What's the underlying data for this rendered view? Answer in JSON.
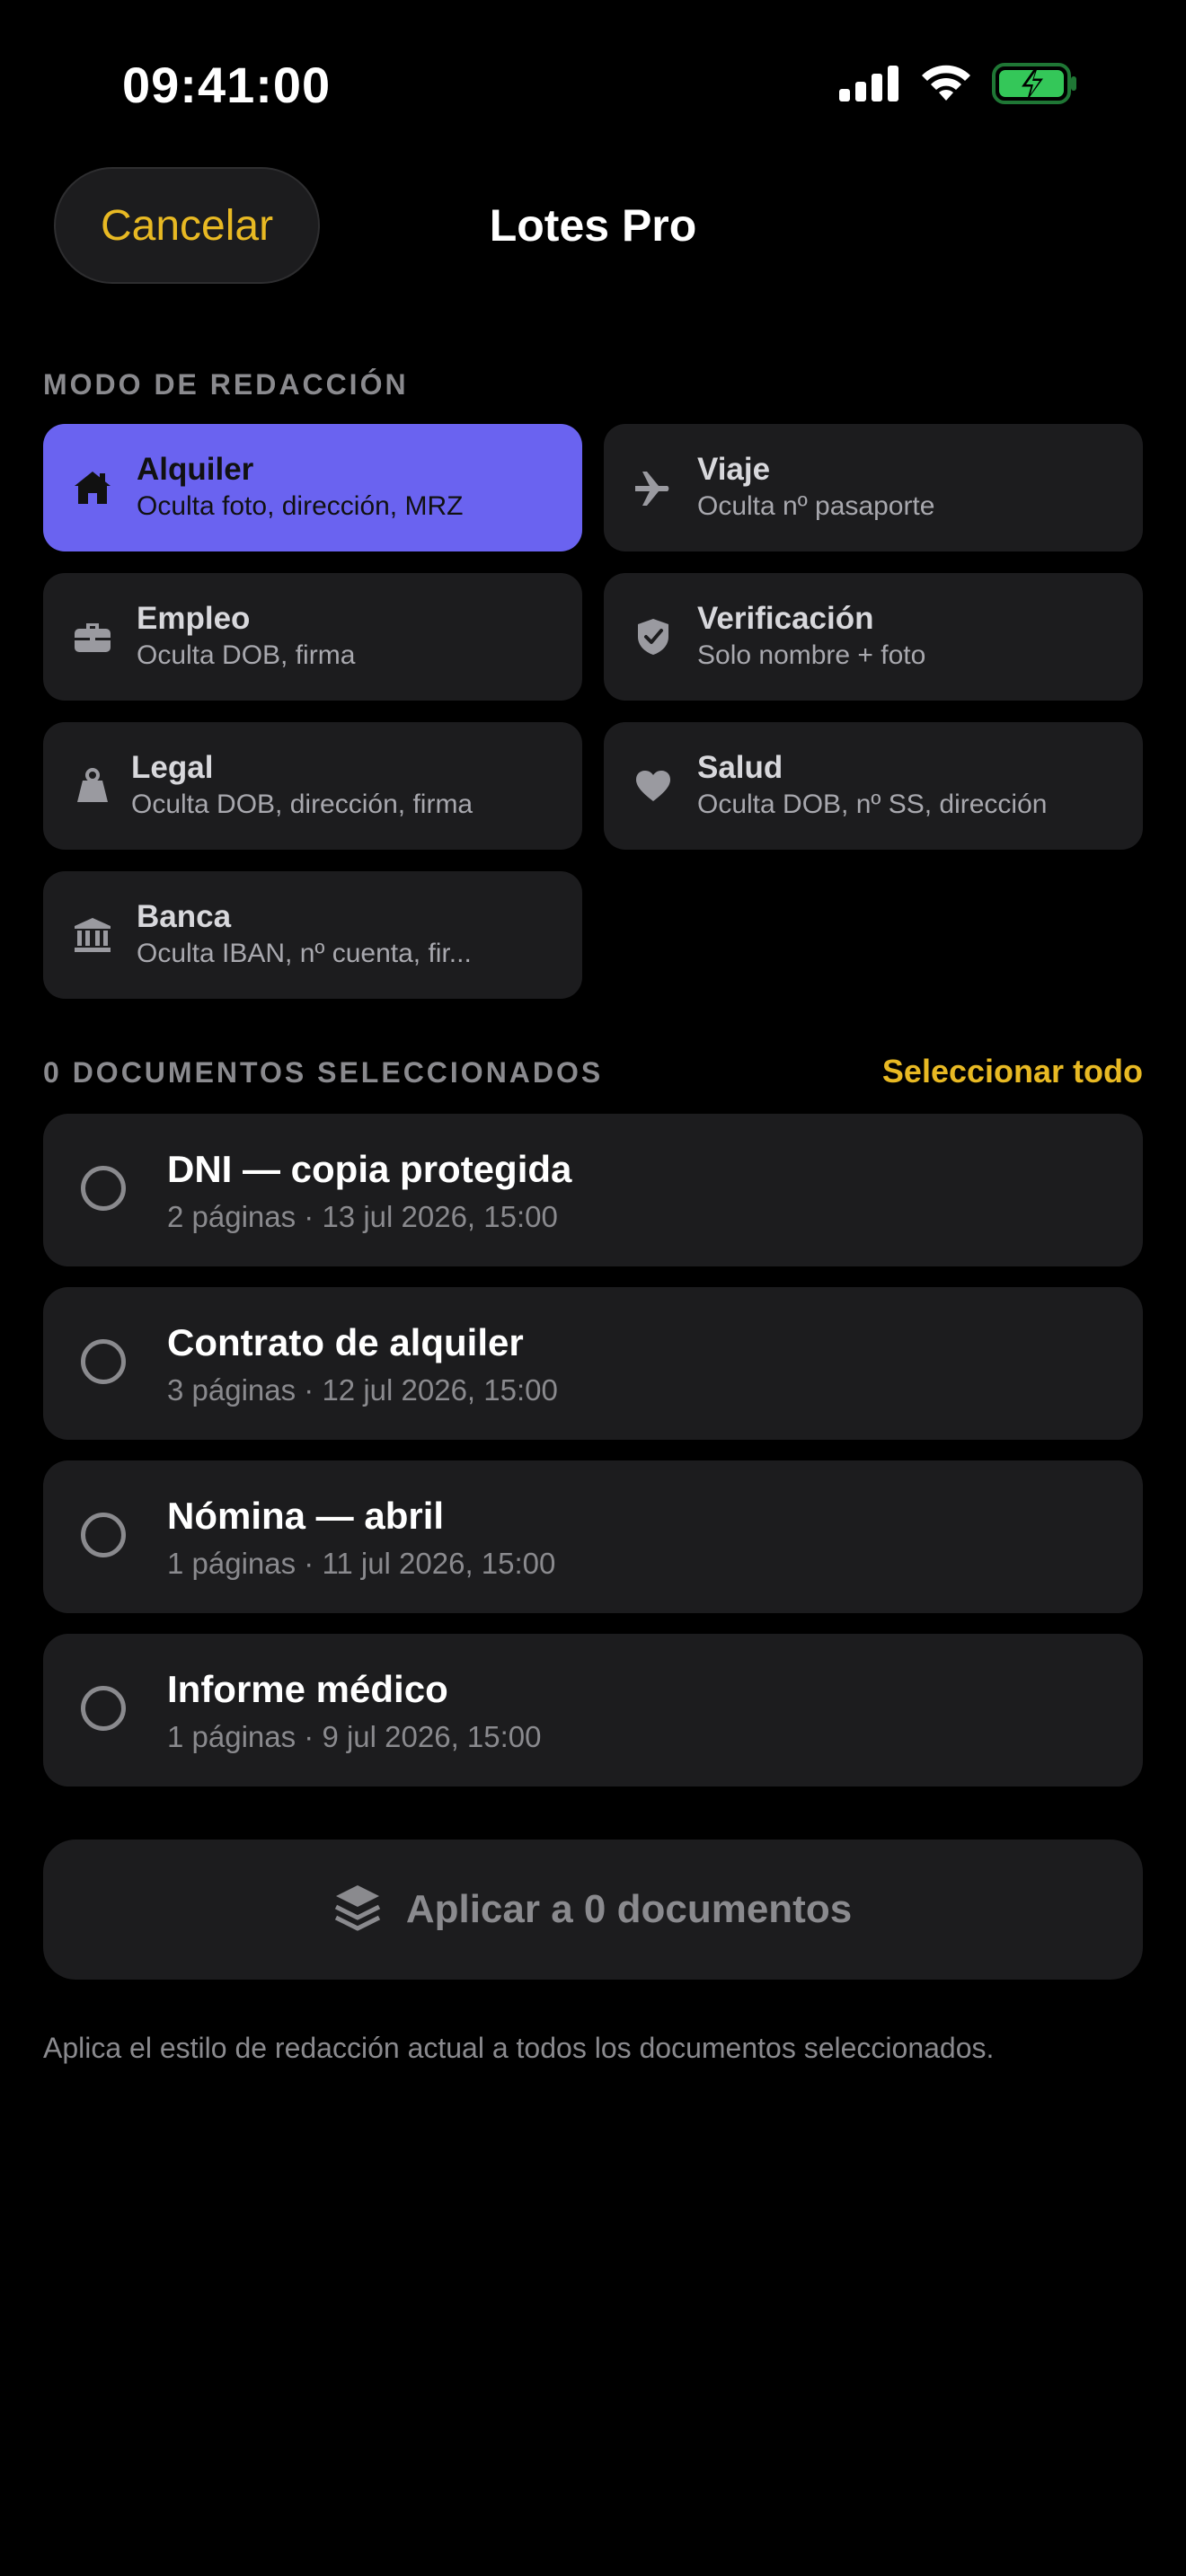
{
  "status_bar": {
    "time": "09:41:00",
    "signal_icon": "cellular-signal-icon",
    "wifi_icon": "wifi-icon",
    "battery_icon": "battery-charging-icon",
    "battery_color": "#34c759"
  },
  "nav": {
    "cancel_label": "Cancelar",
    "title": "Lotes Pro"
  },
  "modes_section": {
    "header": "MODO DE REDACCIÓN",
    "items": [
      {
        "title": "Alquiler",
        "subtitle": "Oculta foto, dirección, MRZ",
        "icon": "house-icon",
        "selected": true
      },
      {
        "title": "Viaje",
        "subtitle": "Oculta nº pasaporte",
        "icon": "airplane-icon",
        "selected": false
      },
      {
        "title": "Empleo",
        "subtitle": "Oculta DOB, firma",
        "icon": "briefcase-icon",
        "selected": false
      },
      {
        "title": "Verificación",
        "subtitle": "Solo nombre + foto",
        "icon": "shield-check-icon",
        "selected": false
      },
      {
        "title": "Legal",
        "subtitle": "Oculta DOB, dirección, firma",
        "icon": "weight-icon",
        "selected": false
      },
      {
        "title": "Salud",
        "subtitle": "Oculta DOB, nº SS, dirección",
        "icon": "heart-icon",
        "selected": false
      },
      {
        "title": "Banca",
        "subtitle": "Oculta IBAN, nº cuenta, fir...",
        "icon": "bank-icon",
        "selected": false
      }
    ]
  },
  "documents_section": {
    "header": "0 DOCUMENTOS SELECCIONADOS",
    "select_all_label": "Seleccionar todo",
    "items": [
      {
        "title": "DNI — copia protegida",
        "meta": "2 páginas · 13 jul 2026, 15:00",
        "selected": false
      },
      {
        "title": "Contrato de alquiler",
        "meta": "3 páginas · 12 jul 2026, 15:00",
        "selected": false
      },
      {
        "title": "Nómina — abril",
        "meta": "1 páginas · 11 jul 2026, 15:00",
        "selected": false
      },
      {
        "title": "Informe médico",
        "meta": "1 páginas · 9 jul 2026, 15:00",
        "selected": false
      }
    ]
  },
  "apply": {
    "label": "Aplicar a 0 documentos",
    "icon": "layers-icon"
  },
  "footer_note": "Aplica el estilo de redacción actual a todos los documentos seleccionados.",
  "colors": {
    "accent": "#e8b923",
    "selected_card": "#6a63f0",
    "card_bg": "#1c1c1e",
    "background": "#000000"
  }
}
